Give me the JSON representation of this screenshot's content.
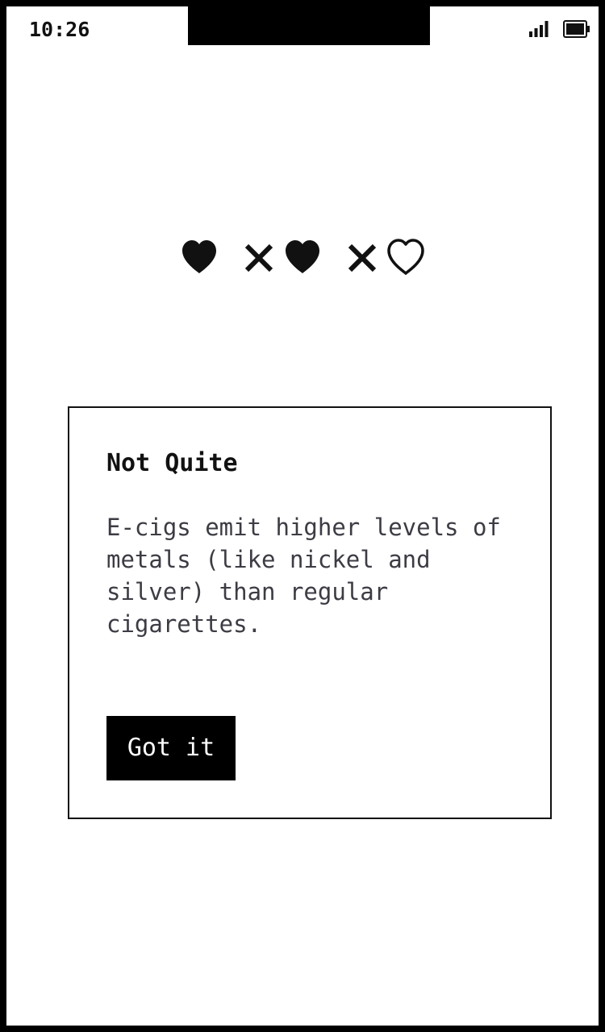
{
  "status_bar": {
    "time": "10:26",
    "signal_icon": "signal-bars-icon",
    "battery_icon": "battery-full-icon"
  },
  "progress": {
    "items": [
      {
        "icon": "heart-filled-icon",
        "state": "correct"
      },
      {
        "icon": "x-mark-icon",
        "state": "incorrect"
      },
      {
        "icon": "heart-filled-icon",
        "state": "correct"
      },
      {
        "icon": "x-mark-icon",
        "state": "incorrect"
      },
      {
        "icon": "heart-outline-icon",
        "state": "pending"
      }
    ]
  },
  "feedback_card": {
    "title": "Not Quite",
    "body": "E-cigs emit higher levels of metals (like nickel and silver) than regular cigarettes.",
    "button_label": "Got it"
  },
  "colors": {
    "frame": "#000000",
    "background": "#ffffff",
    "text_primary": "#111111",
    "text_body": "#3c3c44",
    "button_bg": "#000000",
    "button_text": "#ffffff"
  }
}
